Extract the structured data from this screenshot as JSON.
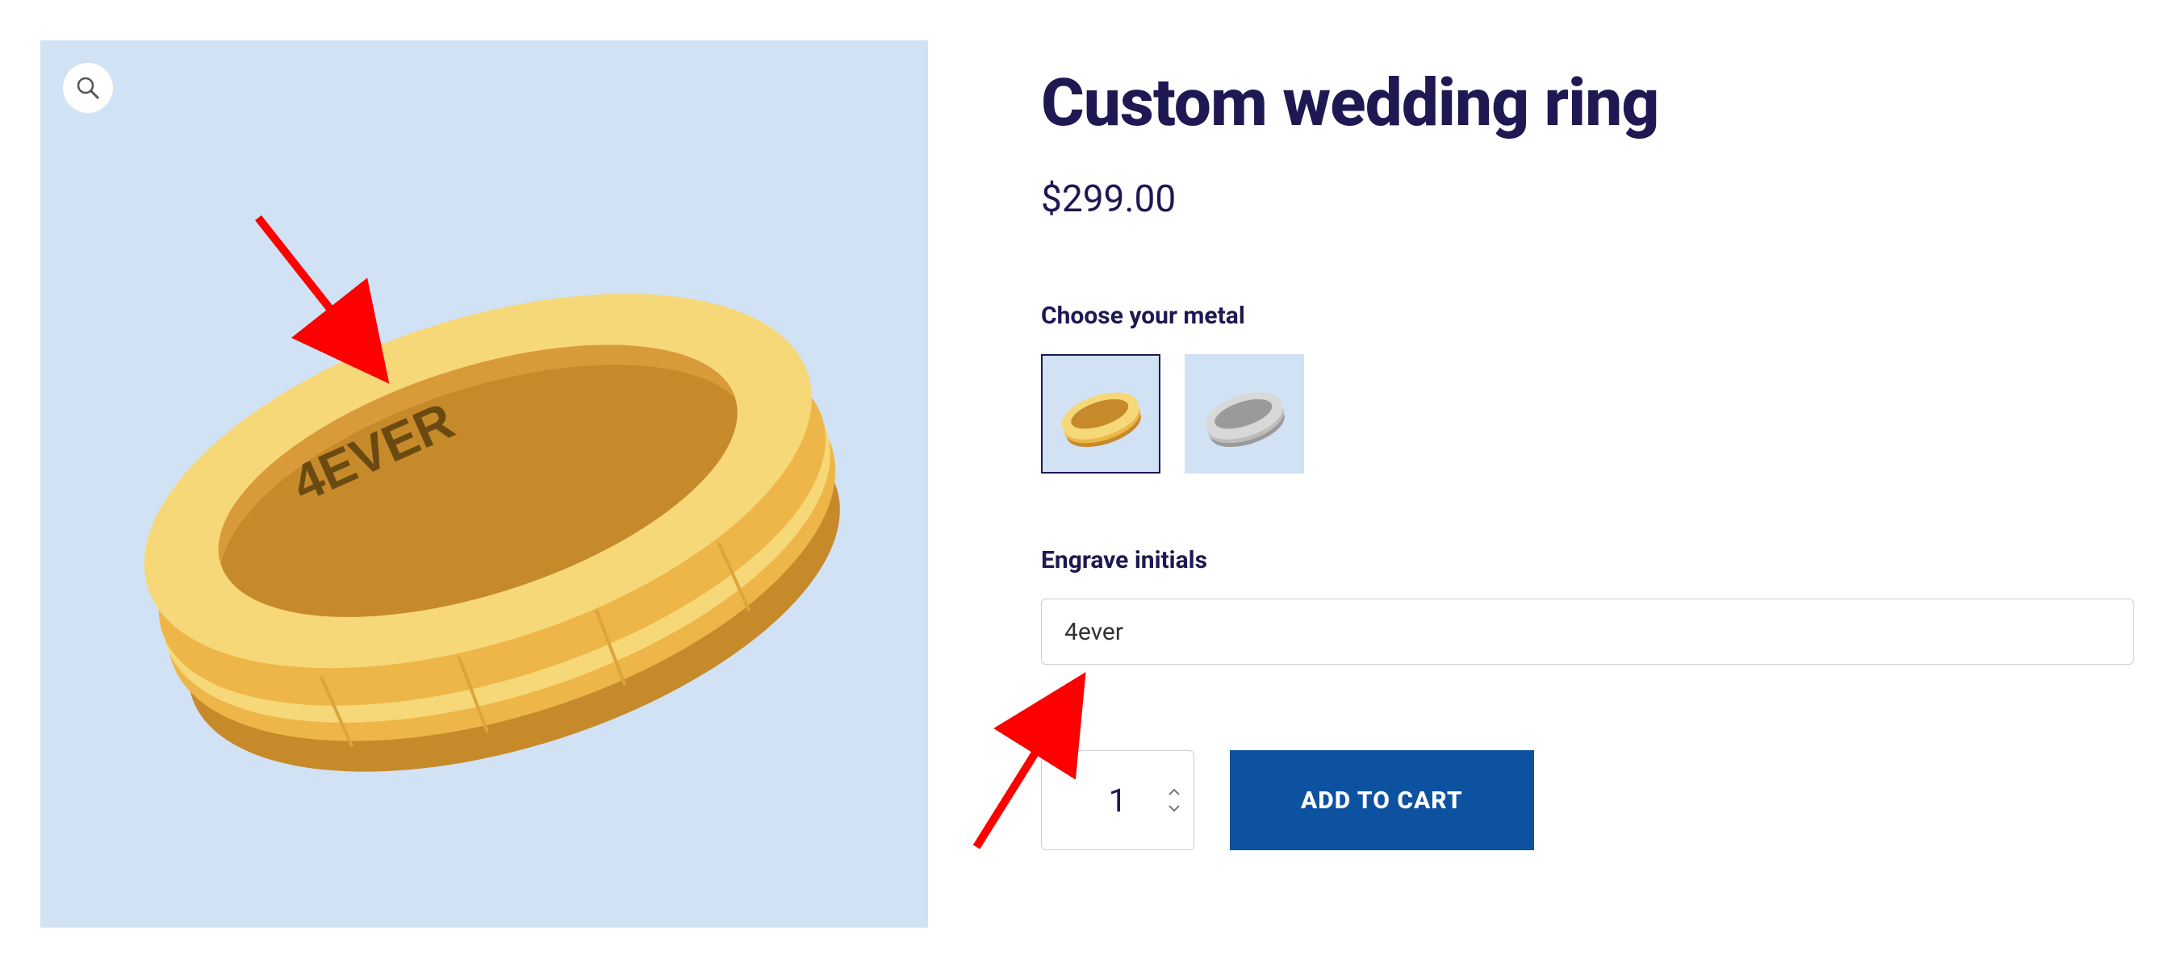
{
  "product": {
    "title": "Custom wedding ring",
    "price": "$299.00",
    "engraving_text": "4EVER"
  },
  "options": {
    "metal_label": "Choose your metal",
    "engrave_label": "Engrave initials",
    "engrave_value": "4ever",
    "swatches": [
      {
        "name": "gold",
        "selected": true
      },
      {
        "name": "silver",
        "selected": false
      }
    ]
  },
  "cart": {
    "quantity": "1",
    "button_label": "ADD TO CART"
  },
  "colors": {
    "brand_dark": "#1e1952",
    "panel_bg": "#d1e2f5",
    "cta_bg": "#0d52a0",
    "gold_light": "#f6d878",
    "gold_mid": "#eeb648",
    "gold_dark": "#c68a2a",
    "silver_light": "#d8d8d8",
    "silver_mid": "#bdbdbd",
    "silver_dark": "#9a9a9a",
    "arrow": "#ff0000"
  }
}
